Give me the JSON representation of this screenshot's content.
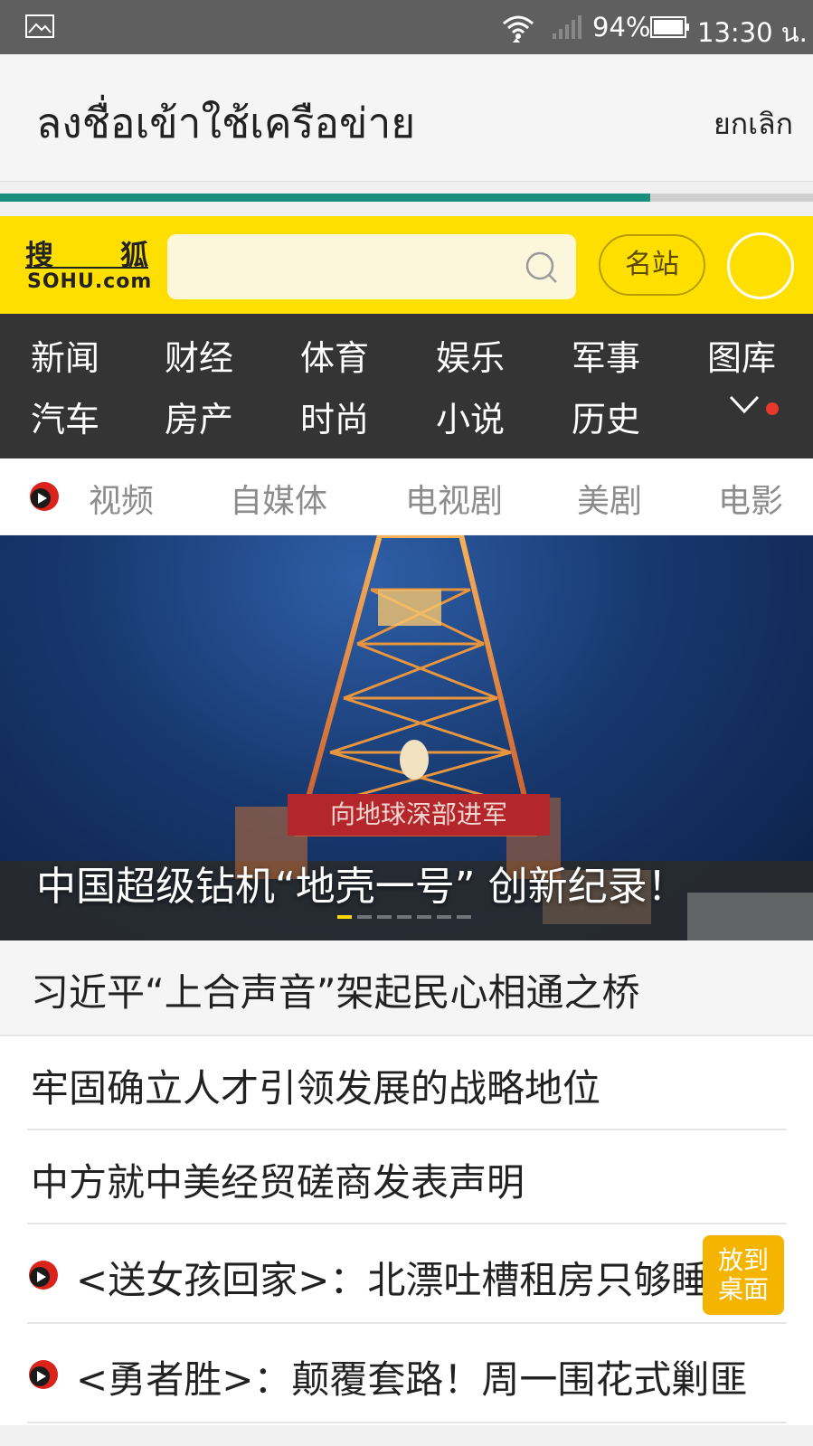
{
  "status_bar": {
    "battery": "94%",
    "time": "13:30 น."
  },
  "login_bar": {
    "title": "ลงชื่อเข้าใช้เครือข่าย",
    "cancel": "ยกเลิก"
  },
  "page_progress": 0.8,
  "sohu": {
    "logo_cn_1": "搜",
    "logo_cn_2": "狐",
    "logo_en": "SOHU.com",
    "search_value": "",
    "famous_sites": "名站"
  },
  "channels": {
    "row1": [
      "新闻",
      "财经",
      "体育",
      "娱乐",
      "军事",
      "图库"
    ],
    "row2": [
      "汽车",
      "房产",
      "时尚",
      "小说",
      "历史"
    ]
  },
  "video_tabs": [
    "视频",
    "自媒体",
    "电视剧",
    "美剧",
    "电影"
  ],
  "hero": {
    "caption": "中国超级钻机“地壳一号” 创新纪录！",
    "sign_text": "向地球深部进军",
    "slide_count": 7,
    "active_slide": 1
  },
  "news": [
    "习近平“上合声音”架起民心相通之桥",
    "牢固确立人才引领发展的战略地位",
    "中方就中美经贸磋商发表声明",
    "<送女孩回家>：北漂吐槽租房只够睡",
    "<勇者胜>：颠覆套路！周一围花式剿匪"
  ],
  "desk_button": {
    "line1": "放到",
    "line2": "桌面"
  },
  "colors": {
    "sohu_yellow": "#fedf00",
    "progress_green": "#178f7c",
    "channel_bg": "#343434",
    "play_red": "#d9231b"
  }
}
